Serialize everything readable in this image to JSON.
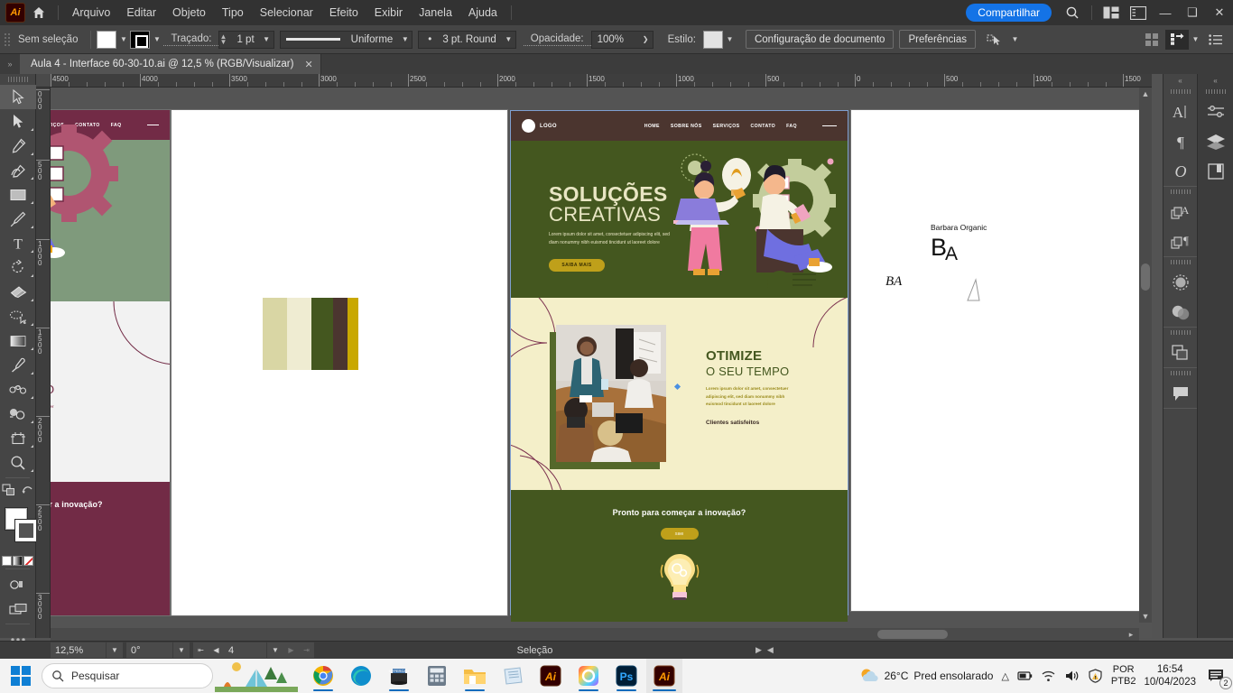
{
  "app": {
    "name": "Adobe Illustrator",
    "logo_text": "Ai",
    "menus": [
      "Arquivo",
      "Editar",
      "Objeto",
      "Tipo",
      "Selecionar",
      "Efeito",
      "Exibir",
      "Janela",
      "Ajuda"
    ],
    "share_label": "Compartilhar"
  },
  "control_bar": {
    "selection_state": "Sem seleção",
    "stroke_label": "Traçado:",
    "stroke_weight": "1 pt",
    "profile": "Uniforme",
    "brush": "3 pt. Round",
    "opacity_label": "Opacidade:",
    "opacity_value": "100%",
    "style_label": "Estilo:",
    "doc_setup": "Configuração de documento",
    "preferences": "Preferências"
  },
  "document": {
    "tab_title": "Aula 4 - Interface 60-30-10.ai @ 12,5 % (RGB/Visualizar)",
    "close_glyph": "✕"
  },
  "rulers": {
    "h_labels": [
      "4500",
      "4000",
      "3500",
      "3000",
      "2500",
      "2000",
      "1500",
      "1000",
      "500",
      "0",
      "500",
      "1000",
      "1500"
    ],
    "v_labels": [
      "0",
      "500",
      "1000",
      "1500",
      "2000",
      "2500",
      "3000"
    ]
  },
  "tools": [
    {
      "name": "selection-tool",
      "glyph": "selection"
    },
    {
      "name": "direct-selection-tool",
      "glyph": "direct"
    },
    {
      "name": "pen-tool",
      "glyph": "pen"
    },
    {
      "name": "curvature-tool",
      "glyph": "curvature"
    },
    {
      "name": "rectangle-tool",
      "glyph": "rect"
    },
    {
      "name": "paintbrush-tool",
      "glyph": "brush"
    },
    {
      "name": "type-tool",
      "glyph": "T"
    },
    {
      "name": "rotate-tool",
      "glyph": "rotate"
    },
    {
      "name": "eraser-tool",
      "glyph": "eraser"
    },
    {
      "name": "lasso-tool",
      "glyph": "lasso"
    },
    {
      "name": "gradient-tool",
      "glyph": "gradient"
    },
    {
      "name": "eyedropper-tool",
      "glyph": "eyedropper"
    },
    {
      "name": "blend-tool",
      "glyph": "blend"
    },
    {
      "name": "shape-builder-tool",
      "glyph": "shapebuilder"
    },
    {
      "name": "artboard-tool",
      "glyph": "artboard"
    },
    {
      "name": "zoom-tool",
      "glyph": "zoom"
    }
  ],
  "right_panels": [
    {
      "name": "character-panel",
      "glyph": "A"
    },
    {
      "name": "paragraph-panel",
      "glyph": "¶"
    },
    {
      "name": "glyphs-panel",
      "glyph": "O"
    },
    {
      "name": "character-styles-panel",
      "glyph": "cstyles"
    },
    {
      "name": "paragraph-styles-panel",
      "glyph": "pstyles"
    },
    {
      "name": "appearance-panel",
      "glyph": "appearance"
    },
    {
      "name": "transparency-panel",
      "glyph": "transparency"
    },
    {
      "name": "pathfinder-panel",
      "glyph": "pathfinder"
    },
    {
      "name": "comments-panel",
      "glyph": "comment"
    }
  ],
  "right_dock": [
    {
      "name": "properties-panel",
      "glyph": "sliders"
    },
    {
      "name": "layers-panel",
      "glyph": "layers"
    },
    {
      "name": "libraries-panel",
      "glyph": "book"
    }
  ],
  "status_bar": {
    "zoom": "12,5%",
    "rotation": "0°",
    "artboard_number": "4",
    "tool_status": "Seleção"
  },
  "artwork": {
    "palette": {
      "label": "color-palette-swatches",
      "colors": [
        "#d9d6a4",
        "#efecd2",
        "#44571f",
        "#4b352f",
        "#c9a800"
      ]
    },
    "hero": {
      "logo_text": "LOGO",
      "nav": [
        "HOME",
        "SOBRE NÓS",
        "SERVIÇOS",
        "CONTATO",
        "FAQ"
      ],
      "title_line1": "SOLUÇÕES",
      "title_line2": "CREATIVAS",
      "paragraph": "Lorem ipsum dolor sit amet, consectetuer adipiscing elit, sed diam nonummy nibh euismod tincidunt ut laoreet dolore",
      "cta": "SAIBA MAIS"
    },
    "section2": {
      "title_line1": "OTIMIZE",
      "title_line2": "O SEU TEMPO",
      "paragraph": "Lorem ipsum dolor sit amet, consectetuer adipiscing elit, sed diam nonummy nibh euismod tincidunt ut laoreet dolore",
      "kpi": "Clientes satisfeitos"
    },
    "section3": {
      "title": "Pronto para começar a inovação?",
      "cta": "SIM!"
    },
    "logo_sheet": {
      "brand_name": "Barbara Organic",
      "monogram_b": "B",
      "monogram_a": "A",
      "script_mark": "BA"
    },
    "colors": {
      "hero_bg": "#44571f",
      "hero_nav_bg": "#4b352f",
      "hero_title": "#e9e6c4",
      "cta_bg": "#bfa01a",
      "section2_bg": "#f4efc9",
      "section2_title": "#44571f",
      "section3_bg": "#44571f",
      "alt_primary": "#722b46",
      "alt_nav": "#722b46",
      "alt_hero_bg": "#7f9a7c"
    }
  },
  "taskbar": {
    "search_placeholder": "Pesquisar",
    "apps": [
      "Google Chrome",
      "Microsoft Edge",
      "App",
      "Calculadora",
      "Explorador de Arquivos",
      "Bloco de Notas",
      "Illustrator",
      "Creative Cloud",
      "Photoshop",
      "Illustrator"
    ],
    "weather_temp": "26°C",
    "weather_desc": "Pred ensolarado",
    "language_line1": "POR",
    "language_line2": "PTB2",
    "time": "16:54",
    "date": "10/04/2023",
    "notification_count": "2"
  }
}
